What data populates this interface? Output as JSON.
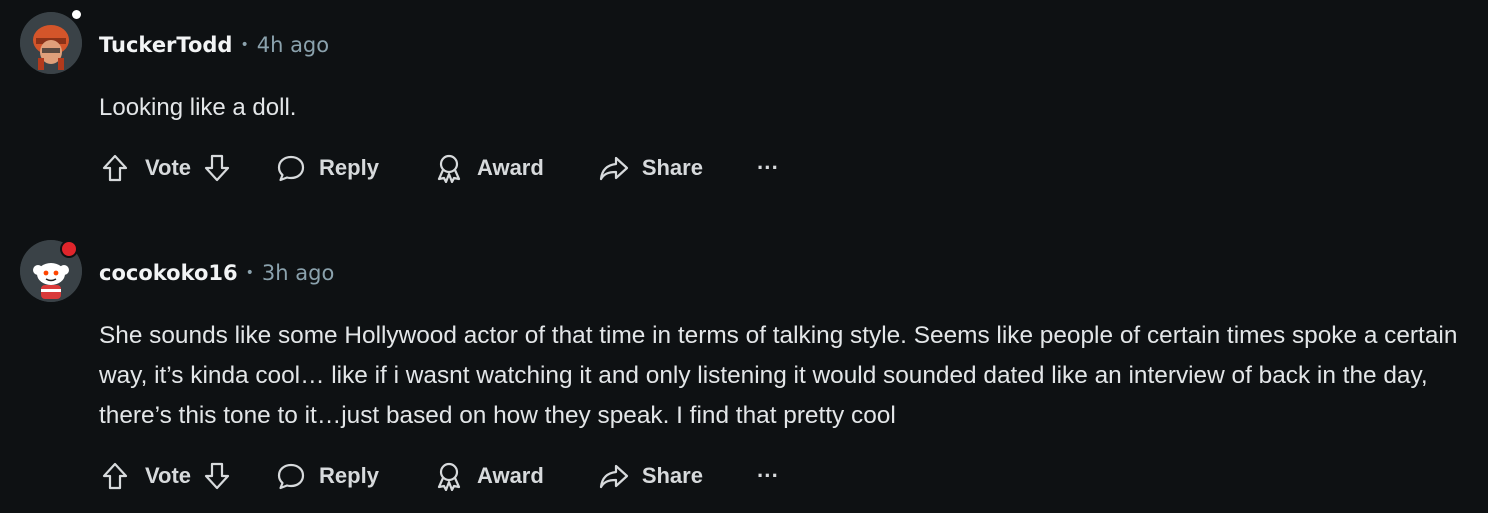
{
  "comments": [
    {
      "author": "TuckerTodd",
      "separator": "•",
      "time": "4h ago",
      "text": "Looking like a doll.",
      "avatar": "orange-helmet-avatar",
      "actions": {
        "vote": "Vote",
        "reply": "Reply",
        "award": "Award",
        "share": "Share",
        "more": "···"
      }
    },
    {
      "author": "cocokoko16",
      "separator": "•",
      "time": "3h ago",
      "text": "She sounds like some Hollywood actor of that time in terms of talking style. Seems like people of certain times spoke a certain way, it’s kinda cool… like if i wasnt watching it and only listening it would sounded dated like an interview of back in the day, there’s this tone to it…just based on how they speak. I find that pretty cool",
      "avatar": "snoo-turkey-flag-avatar",
      "actions": {
        "vote": "Vote",
        "reply": "Reply",
        "award": "Award",
        "share": "Share",
        "more": "···"
      }
    }
  ],
  "colors": {
    "background": "#0e1113",
    "text": "#d7dadc",
    "muted": "#8ba2ad"
  }
}
